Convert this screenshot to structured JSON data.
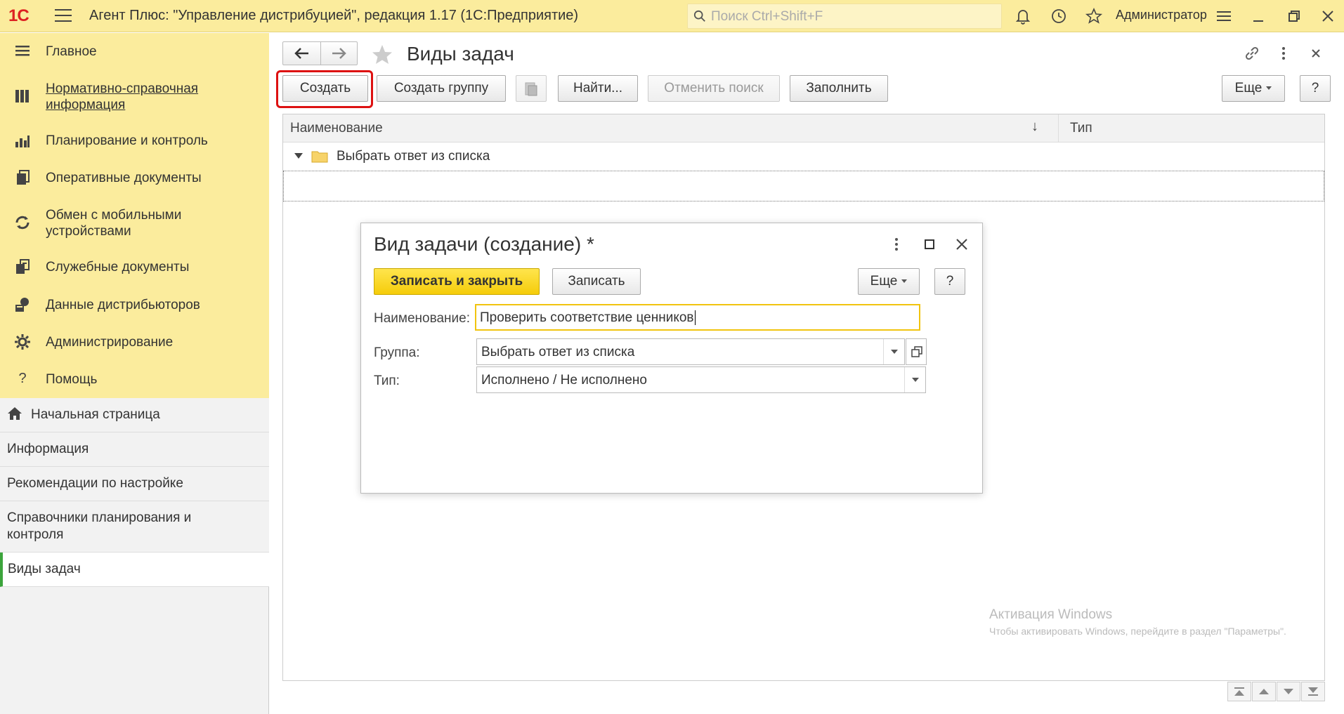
{
  "topbar": {
    "logo": "1С",
    "title": "Агент Плюс: \"Управление дистрибуцией\", редакция 1.17  (1С:Предприятие)",
    "search_placeholder": "Поиск Ctrl+Shift+F",
    "user": "Администратор"
  },
  "sidebar": {
    "sections": [
      {
        "label": "Главное",
        "icon": "menu-lines-icon"
      },
      {
        "label": "Нормативно-справочная информация",
        "icon": "table-icon"
      },
      {
        "label": "Планирование и контроль",
        "icon": "bar-chart-icon"
      },
      {
        "label": "Оперативные документы",
        "icon": "documents-icon"
      },
      {
        "label": "Обмен с мобильными устройствами",
        "icon": "sync-icon"
      },
      {
        "label": "Служебные документы",
        "icon": "service-docs-icon"
      },
      {
        "label": "Данные дистрибьюторов",
        "icon": "distributor-icon"
      },
      {
        "label": "Администрирование",
        "icon": "gear-icon"
      },
      {
        "label": "Помощь",
        "icon": "help-icon"
      }
    ],
    "open_windows": [
      {
        "label": "Начальная страница"
      },
      {
        "label": "Информация"
      },
      {
        "label": "Рекомендации по настройке"
      },
      {
        "label": "Справочники планирования и контроля"
      },
      {
        "label": "Виды задач"
      }
    ]
  },
  "form": {
    "title": "Виды задач",
    "buttons": {
      "create": "Создать",
      "create_group": "Создать группу",
      "find": "Найти...",
      "cancel_search": "Отменить поиск",
      "fill": "Заполнить",
      "more": "Еще",
      "help": "?"
    },
    "columns": {
      "name": "Наименование",
      "sort_indicator": "↓",
      "type": "Тип"
    },
    "rows": [
      {
        "name": "Выбрать ответ из списка"
      }
    ],
    "watermark": {
      "title": "Активация Windows",
      "text": "Чтобы активировать Windows, перейдите в раздел \"Параметры\"."
    }
  },
  "modal": {
    "title": "Вид задачи (создание) *",
    "buttons": {
      "save_close": "Записать и закрыть",
      "save": "Записать",
      "more": "Еще",
      "help": "?"
    },
    "fields": {
      "name_label": "Наименование:",
      "name_value": "Проверить соответствие ценников",
      "group_label": "Группа:",
      "group_value": "Выбрать ответ из списка",
      "type_label": "Тип:",
      "type_value": "Исполнено / Не исполнено"
    }
  },
  "colors": {
    "topbar": "#fbec9d",
    "highlight": "#dd1111",
    "primary_button": "#f5cc0a",
    "active_marker": "#3ca43c"
  }
}
